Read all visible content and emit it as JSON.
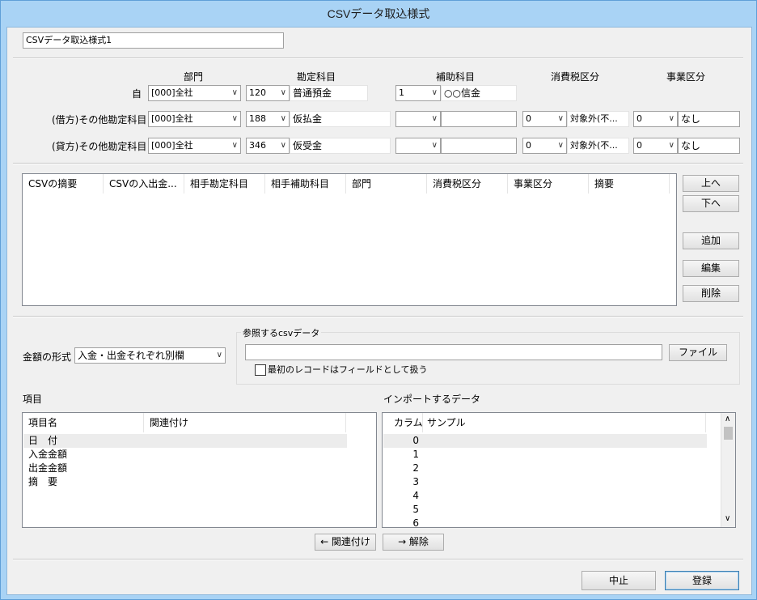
{
  "window": {
    "title": "CSVデータ取込様式"
  },
  "format_name": "CSVデータ取込様式1",
  "top_grid": {
    "headers": {
      "dept": "部門",
      "account": "勘定科目",
      "sub_account": "補助科目",
      "tax": "消費税区分",
      "business": "事業区分"
    },
    "rows": [
      {
        "label": "自",
        "dept": "[000]全社",
        "acct_code": "120",
        "acct_name": "普通預金",
        "sub_code": "1",
        "sub_name": "○○信金",
        "tax_code": "",
        "tax_name": "",
        "biz_code": "",
        "biz_name": ""
      },
      {
        "label": "(借方)その他勘定科目",
        "dept": "[000]全社",
        "acct_code": "188",
        "acct_name": "仮払金",
        "sub_code": "",
        "sub_name": "",
        "tax_code": "0",
        "tax_name": "対象外(不...",
        "biz_code": "0",
        "biz_name": "なし"
      },
      {
        "label": "(貸方)その他勘定科目",
        "dept": "[000]全社",
        "acct_code": "346",
        "acct_name": "仮受金",
        "sub_code": "",
        "sub_name": "",
        "tax_code": "0",
        "tax_name": "対象外(不...",
        "biz_code": "0",
        "biz_name": "なし"
      }
    ]
  },
  "mapping_list": {
    "columns": [
      "CSVの摘要",
      "CSVの入出金...",
      "相手勘定科目",
      "相手補助科目",
      "部門",
      "消費税区分",
      "事業区分",
      "摘要"
    ]
  },
  "side_buttons": {
    "up": "上へ",
    "down": "下へ",
    "add": "追加",
    "edit": "編集",
    "delete": "削除"
  },
  "amount_format": {
    "label": "金額の形式",
    "value": "入金・出金それぞれ別欄"
  },
  "csv_ref": {
    "group_title": "参照するcsvデータ",
    "path": "",
    "file_button": "ファイル",
    "first_record_label": "最初のレコードはフィールドとして扱う"
  },
  "items": {
    "title": "項目",
    "columns": [
      "項目名",
      "関連付け"
    ],
    "rows": [
      "日　付",
      "入金金額",
      "出金金額",
      "摘　要"
    ]
  },
  "import_data": {
    "title": "インポートするデータ",
    "columns": [
      "カラム",
      "サンプル"
    ],
    "rows": [
      "0",
      "1",
      "2",
      "3",
      "4",
      "5",
      "6"
    ]
  },
  "link_buttons": {
    "link": "← 関連付け",
    "unlink": "→ 解除"
  },
  "footer": {
    "cancel": "中止",
    "register": "登録"
  }
}
